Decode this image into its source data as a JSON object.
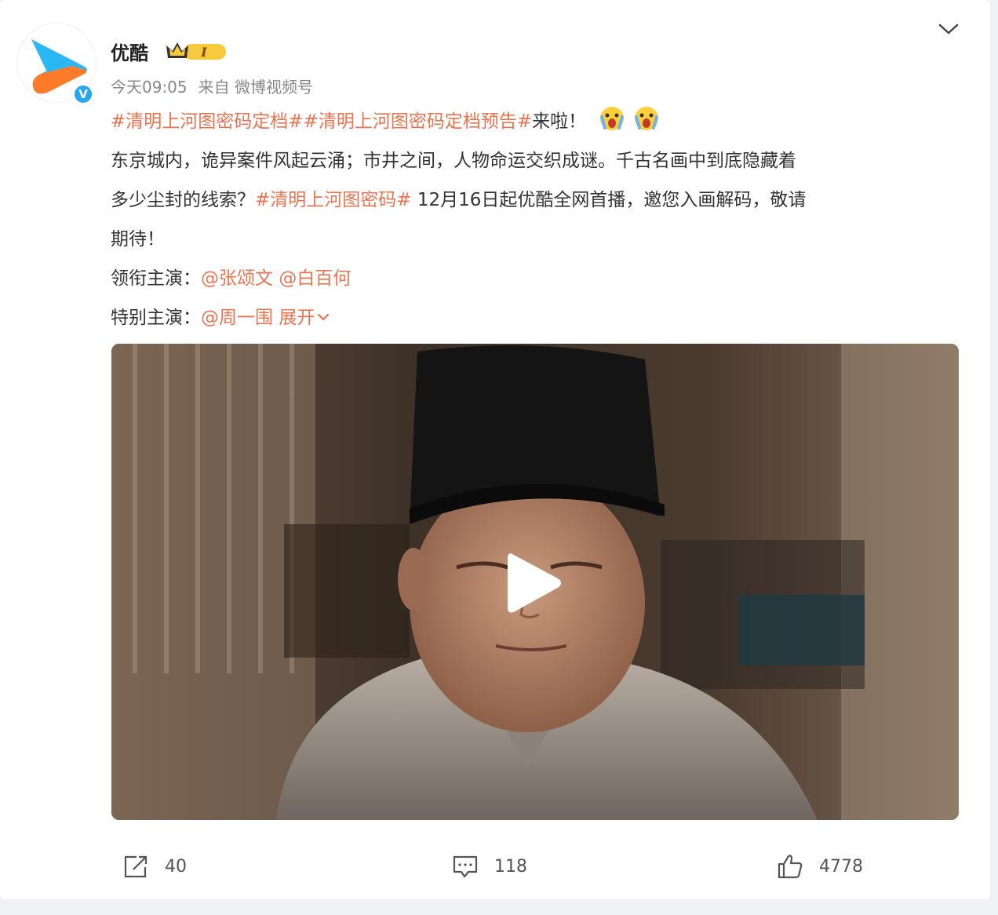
{
  "post": {
    "username": "优酷",
    "vip_level": "I",
    "verified_mark": "V",
    "timestamp": "今天09:05",
    "source": "来自 微博视频号",
    "text": {
      "line1_tag": "#清明上河图密码定档##清明上河图密码定档预告#",
      "line1_rest": "来啦！",
      "line2": "东京城内，诡异案件风起云涌；市井之间，人物命运交织成谜。千古名画中到底隐藏着",
      "line3_pre": "多少尘封的线索？",
      "line3_tag": "#清明上河图密码#",
      "line3_post": " 12月16日起优酷全网首播，邀您入画解码，敬请",
      "line4": "期待！",
      "lead_label": "领衔主演：",
      "lead_mention1": "@张颂文",
      "lead_mention2": "@白百何",
      "special_label": "特别主演：",
      "special_mention": "@周一围",
      "expand": "展开"
    },
    "actions": {
      "share_count": "40",
      "comment_count": "118",
      "like_count": "4778"
    },
    "icons": [
      "chevron-down-icon",
      "crown-icon",
      "verified-icon",
      "surprised-emoji-icon",
      "play-icon",
      "share-icon",
      "comment-icon",
      "like-icon"
    ],
    "colors": {
      "link": "#eb7350",
      "meta": "#888888",
      "verified": "#27a6f2",
      "logo_blue": "#2bb6f4",
      "logo_orange": "#ff7b2a"
    }
  }
}
